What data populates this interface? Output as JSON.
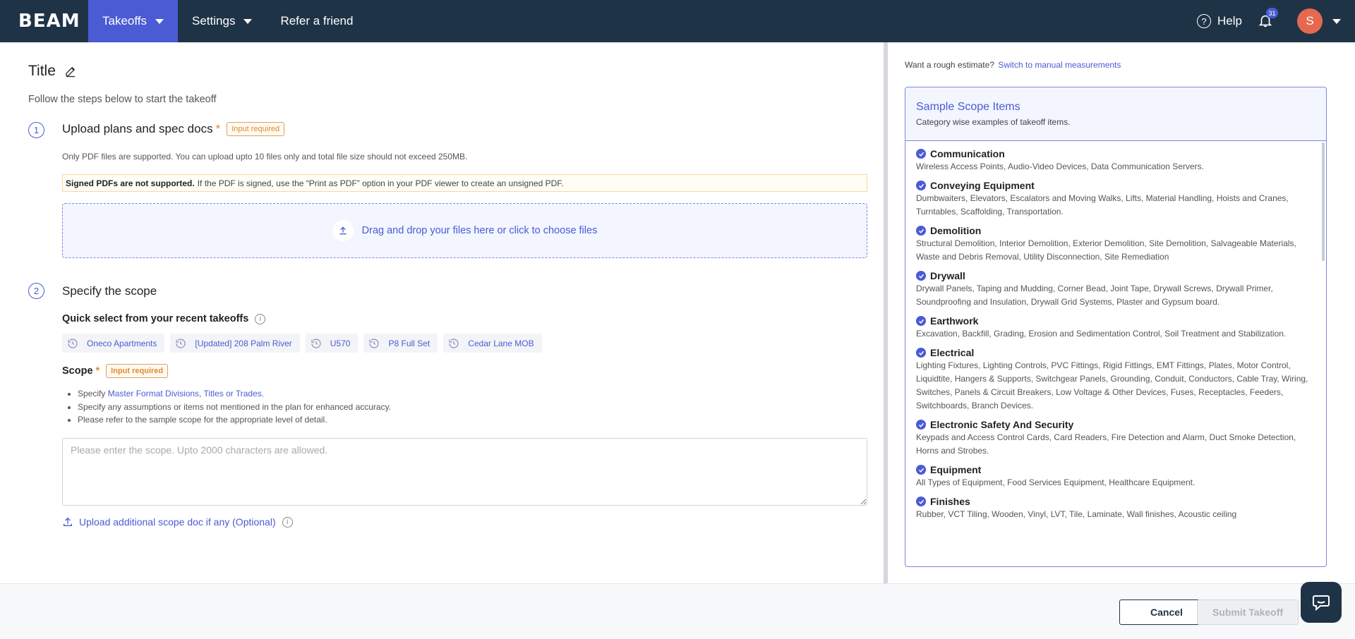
{
  "nav": {
    "logo": "BEAM",
    "takeoffs": "Takeoffs",
    "settings": "Settings",
    "refer": "Refer a friend",
    "help": "Help",
    "notifications_count": "31",
    "avatar_initial": "S"
  },
  "page": {
    "title": "Title",
    "subtitle": "Follow the steps below to start the takeoff"
  },
  "step1": {
    "number": "1",
    "title": "Upload plans and spec docs",
    "required_star": "*",
    "required_badge": "Input required",
    "note": "Only PDF files are supported. You can upload upto 10 files only and total file size should not exceed 250MB.",
    "warning_bold": "Signed PDFs are not supported.",
    "warning_text": "If the PDF is signed, use the “Print as PDF” option in your PDF viewer to create an unsigned PDF.",
    "dropzone_text": "Drag and drop your files here or click to choose files"
  },
  "step2": {
    "number": "2",
    "title": "Specify the scope",
    "quick_select_title": "Quick select from your recent takeoffs",
    "recent": [
      "Oneco Apartments",
      "[Updated] 208 Palm River",
      "U570",
      "P8 Full Set",
      "Cedar Lane MOB"
    ],
    "scope_label": "Scope",
    "required_star": "*",
    "required_badge": "Input required",
    "bullet1_prefix": "Specify",
    "bullet1_link": "Master Format Divisions, Titles or Trades.",
    "bullet2": "Specify any assumptions or items not mentioned in the plan for enhanced accuracy.",
    "bullet3": "Please refer to the sample scope for the appropriate level of detail.",
    "placeholder": "Please enter the scope. Upto 2000 characters are allowed.",
    "upload_extra": "Upload additional scope doc if any (Optional)"
  },
  "right": {
    "rough_text": "Want a rough estimate?",
    "rough_link": "Switch to manual measurements",
    "sample_title": "Sample Scope Items",
    "sample_sub": "Category wise examples of takeoff items.",
    "categories": [
      {
        "name": "Communication",
        "items": "Wireless Access Points, Audio-Video Devices, Data Communication Servers."
      },
      {
        "name": "Conveying Equipment",
        "items": "Dumbwaiters, Elevators, Escalators and Moving Walks, Lifts, Material Handling, Hoists and Cranes, Turntables, Scaffolding, Transportation."
      },
      {
        "name": "Demolition",
        "items": "Structural Demolition, Interior Demolition, Exterior Demolition, Site Demolition, Salvageable Materials, Waste and Debris Removal, Utility Disconnection, Site Remediation"
      },
      {
        "name": "Drywall",
        "items": "Drywall Panels, Taping and Mudding, Corner Bead, Joint Tape, Drywall Screws, Drywall Primer, Soundproofing and Insulation, Drywall Grid Systems, Plaster and Gypsum board."
      },
      {
        "name": "Earthwork",
        "items": "Excavation, Backfill, Grading, Erosion and Sedimentation Control, Soil Treatment and Stabilization."
      },
      {
        "name": "Electrical",
        "items": "Lighting Fixtures, Lighting Controls, PVC Fittings, Rigid Fittings, EMT Fittings, Plates, Motor Control, Liquidtite, Hangers & Supports, Switchgear Panels, Grounding, Conduit, Conductors, Cable Tray, Wiring, Switches, Panels & Circuit Breakers, Low Voltage & Other Devices, Fuses, Receptacles, Feeders, Switchboards, Branch Devices."
      },
      {
        "name": "Electronic Safety And Security",
        "items": "Keypads and Access Control Cards, Card Readers, Fire Detection and Alarm, Duct Smoke Detection, Horns and Strobes."
      },
      {
        "name": "Equipment",
        "items": "All Types of Equipment, Food Services Equipment, Healthcare Equipment."
      },
      {
        "name": "Finishes",
        "items": "Rubber, VCT Tiling, Wooden, Vinyl, LVT, Tile, Laminate, Wall finishes, Acoustic ceiling"
      }
    ]
  },
  "footer": {
    "cancel": "Cancel",
    "submit": "Submit Takeoff"
  },
  "colors": {
    "nav_bg": "#1f3347",
    "accent": "#4a5bd4",
    "required": "#e0892c",
    "avatar": "#e6694f"
  }
}
